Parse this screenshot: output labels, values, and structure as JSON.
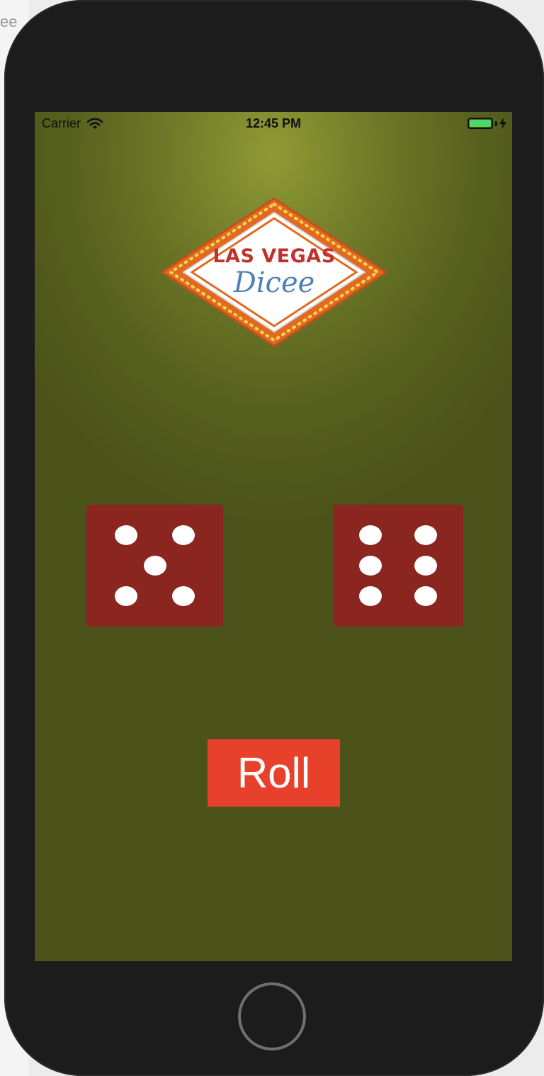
{
  "status_bar": {
    "carrier": "Carrier",
    "time": "12:45 PM",
    "wifi_icon": "wifi-icon",
    "battery_icon": "battery-icon",
    "charging_icon": "bolt-icon",
    "battery_level": 1.0
  },
  "logo": {
    "title": "LAS VEGAS",
    "subtitle": "Dicee"
  },
  "dice": {
    "left_value": 5,
    "right_value": 6,
    "die_color": "#8a2520",
    "pip_color": "#ffffff"
  },
  "roll_button": {
    "label": "Roll",
    "color": "#e8412b"
  },
  "colors": {
    "felt_light": "#8f9a35",
    "felt_dark": "#4b531a",
    "device": "#1c1c1c",
    "battery": "#4cd964"
  },
  "backdrop": {
    "partial_text": "ee"
  }
}
